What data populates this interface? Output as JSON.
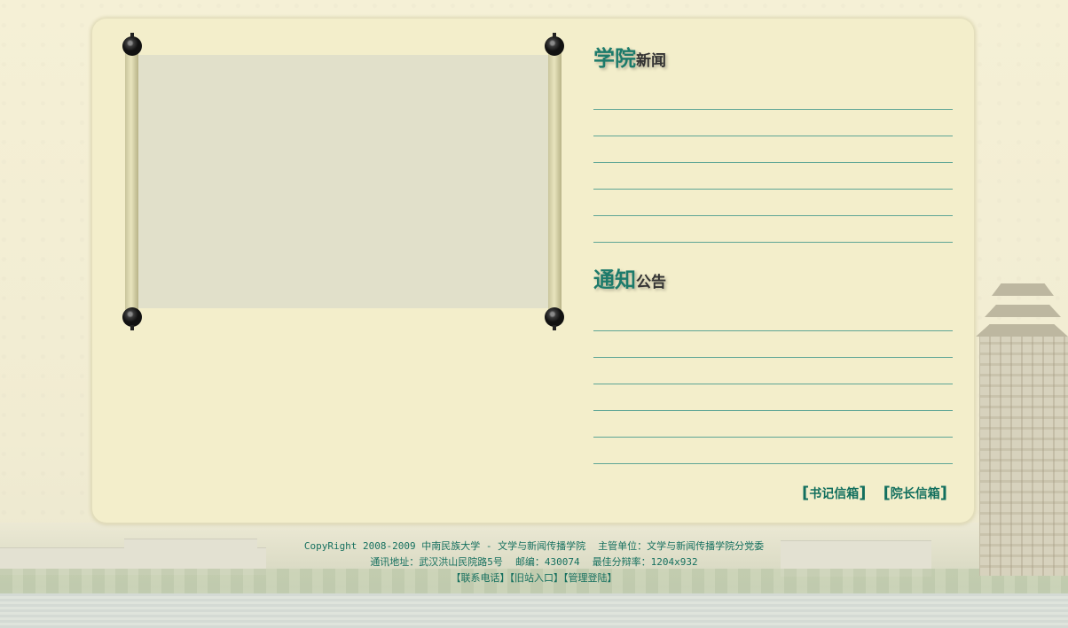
{
  "news": {
    "title_big": "学院",
    "title_small": "新闻",
    "line_count": 6
  },
  "notice": {
    "title_big": "通知",
    "title_small": "公告",
    "line_count": 6
  },
  "mail_links": [
    {
      "label": "书记信箱"
    },
    {
      "label": "院长信箱"
    }
  ],
  "footer": {
    "copyright": "CopyRight 2008-2009 中南民族大学 - 文学与新闻传播学院",
    "sponsor": "主管单位：文学与新闻传播学院分党委",
    "address": "通讯地址：武汉洪山民院路5号",
    "postcode": "邮编：430074",
    "resolution": "最佳分辩率：1204x932",
    "links": [
      "【联系电话】",
      "【旧站入口】",
      "【管理登陆】"
    ]
  },
  "colors": {
    "accent": "#1d7b6b",
    "panel": "#f3eecb",
    "scroll_paper": "#e1e0ca"
  }
}
